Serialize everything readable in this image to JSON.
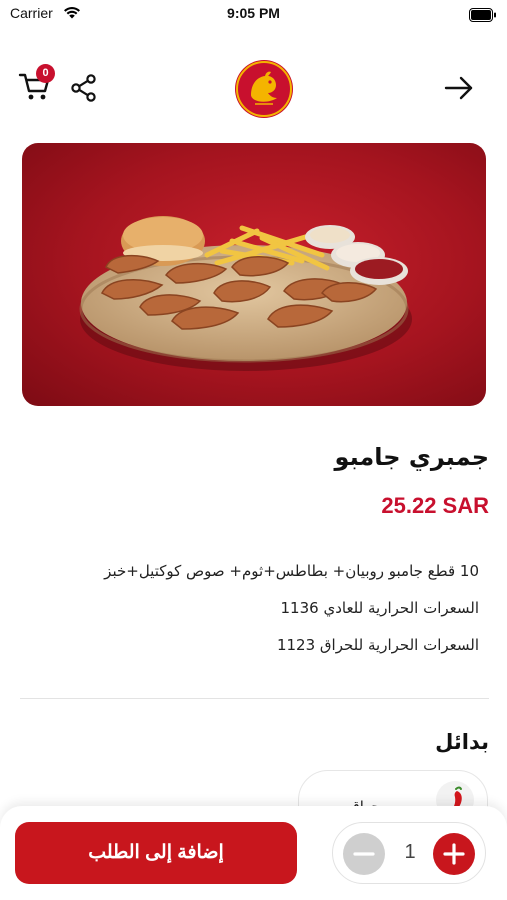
{
  "status_bar": {
    "carrier": "Carrier",
    "time": "9:05 PM"
  },
  "header": {
    "cart_count": "0",
    "icons": [
      "cart-icon",
      "share-icon",
      "back-arrow-icon"
    ]
  },
  "product": {
    "name": "جمبري جامبو",
    "price": "25.22 SAR",
    "description": [
      "10 قطع جامبو روبيان+ بطاطس+ثوم+ صوص كوكتيل+خبز",
      "السعرات الحرارية للعادي 1136",
      "السعرات الحرارية للحراق 1123"
    ]
  },
  "alternatives": {
    "title": "بدائل",
    "card_label": "حراق"
  },
  "bottom_bar": {
    "add_button_label": "إضافة إلى الطلب",
    "quantity": "1"
  },
  "colors": {
    "brand_red": "#c8161d",
    "price_red": "#c8102e",
    "stepper_disabled": "#cfcfcf"
  }
}
